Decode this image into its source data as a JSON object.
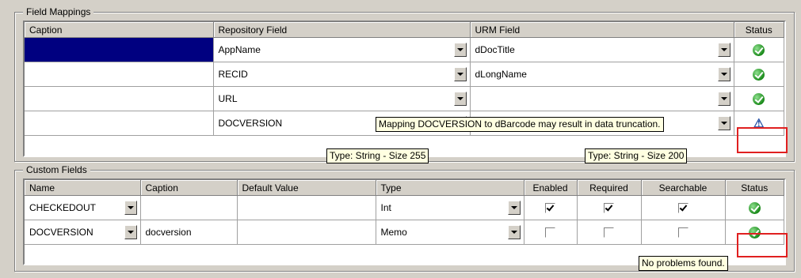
{
  "field_mappings": {
    "title": "Field Mappings",
    "headers": [
      "Caption",
      "Repository Field",
      "URM Field",
      "Status"
    ],
    "rows": [
      {
        "caption": "",
        "repository_field": "AppName",
        "urm_field": "dDocTitle",
        "status": "ok-icon"
      },
      {
        "caption": "",
        "repository_field": "RECID",
        "urm_field": "dLongName",
        "status": "ok-icon"
      },
      {
        "caption": "",
        "repository_field": "URL",
        "urm_field": "",
        "status": "ok-icon"
      },
      {
        "caption": "",
        "repository_field": "DOCVERSION",
        "urm_field": "dBarcode",
        "status": "warning-icon"
      }
    ],
    "tooltips": {
      "truncation": "Mapping DOCVERSION to dBarcode may result in data truncation.",
      "repo_type": "Type: String - Size 255",
      "urm_type": "Type: String - Size 200"
    }
  },
  "custom_fields": {
    "title": "Custom Fields",
    "headers": [
      "Name",
      "Caption",
      "Default Value",
      "Type",
      "Enabled",
      "Required",
      "Searchable",
      "Status"
    ],
    "rows": [
      {
        "name": "CHECKEDOUT",
        "caption": "",
        "default_value": "",
        "type": "Int",
        "enabled": true,
        "required": true,
        "searchable": true,
        "status": "ok-icon"
      },
      {
        "name": "DOCVERSION",
        "caption": "docversion",
        "default_value": "",
        "type": "Memo",
        "enabled": false,
        "required": false,
        "searchable": false,
        "status": "ok-icon"
      }
    ],
    "tooltip": "No problems found."
  },
  "colors": {
    "selection": "#000080",
    "highlight_border": "#e02020",
    "tooltip_bg": "#ffffe1"
  }
}
